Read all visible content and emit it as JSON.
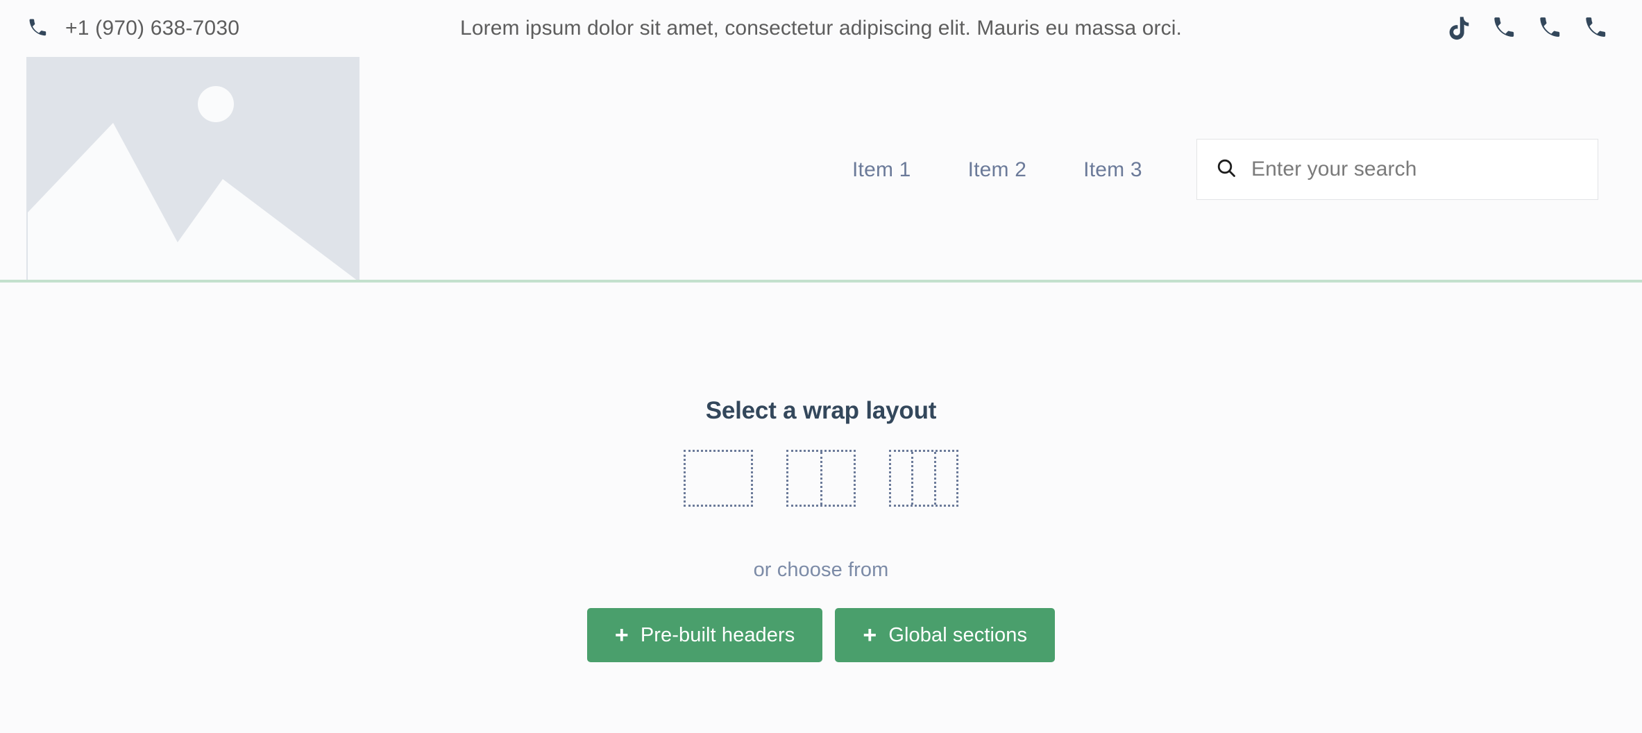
{
  "colors": {
    "page_bg": "#fbfbfc",
    "accent_green": "#4a9f6c",
    "divider_green": "#c3e0cd",
    "heading_navy": "#33475b",
    "muted_blue": "#7c8ba7",
    "nav_blue": "#6b7a99",
    "placeholder_gray": "#dfe3e9"
  },
  "header": {
    "phone": {
      "icon": "phone-icon",
      "number": "+1 (970) 638-7030"
    },
    "tagline": "Lorem ipsum dolor sit amet, consectetur adipiscing elit. Mauris eu massa orci.",
    "social_icons": [
      {
        "name": "tiktok-icon"
      },
      {
        "name": "phone-icon"
      },
      {
        "name": "phone-icon"
      },
      {
        "name": "phone-icon"
      }
    ],
    "logo": {
      "name": "image-placeholder",
      "icon": "image-placeholder-icon"
    },
    "nav_items": [
      {
        "label": "Item 1"
      },
      {
        "label": "Item 2"
      },
      {
        "label": "Item 3"
      }
    ],
    "search": {
      "icon": "search-icon",
      "placeholder": "Enter your search",
      "value": ""
    }
  },
  "main": {
    "wrap_layout_title": "Select a wrap layout",
    "layout_options": [
      {
        "name": "wrap-layout-1-column",
        "columns": 1
      },
      {
        "name": "wrap-layout-2-column",
        "columns": 2
      },
      {
        "name": "wrap-layout-3-column",
        "columns": 3
      }
    ],
    "choose_from_label": "or choose from",
    "buttons": [
      {
        "name": "pre-built-headers-button",
        "icon": "plus-icon",
        "plus": "+",
        "label": "Pre-built headers"
      },
      {
        "name": "global-sections-button",
        "icon": "plus-icon",
        "plus": "+",
        "label": "Global sections"
      }
    ]
  }
}
